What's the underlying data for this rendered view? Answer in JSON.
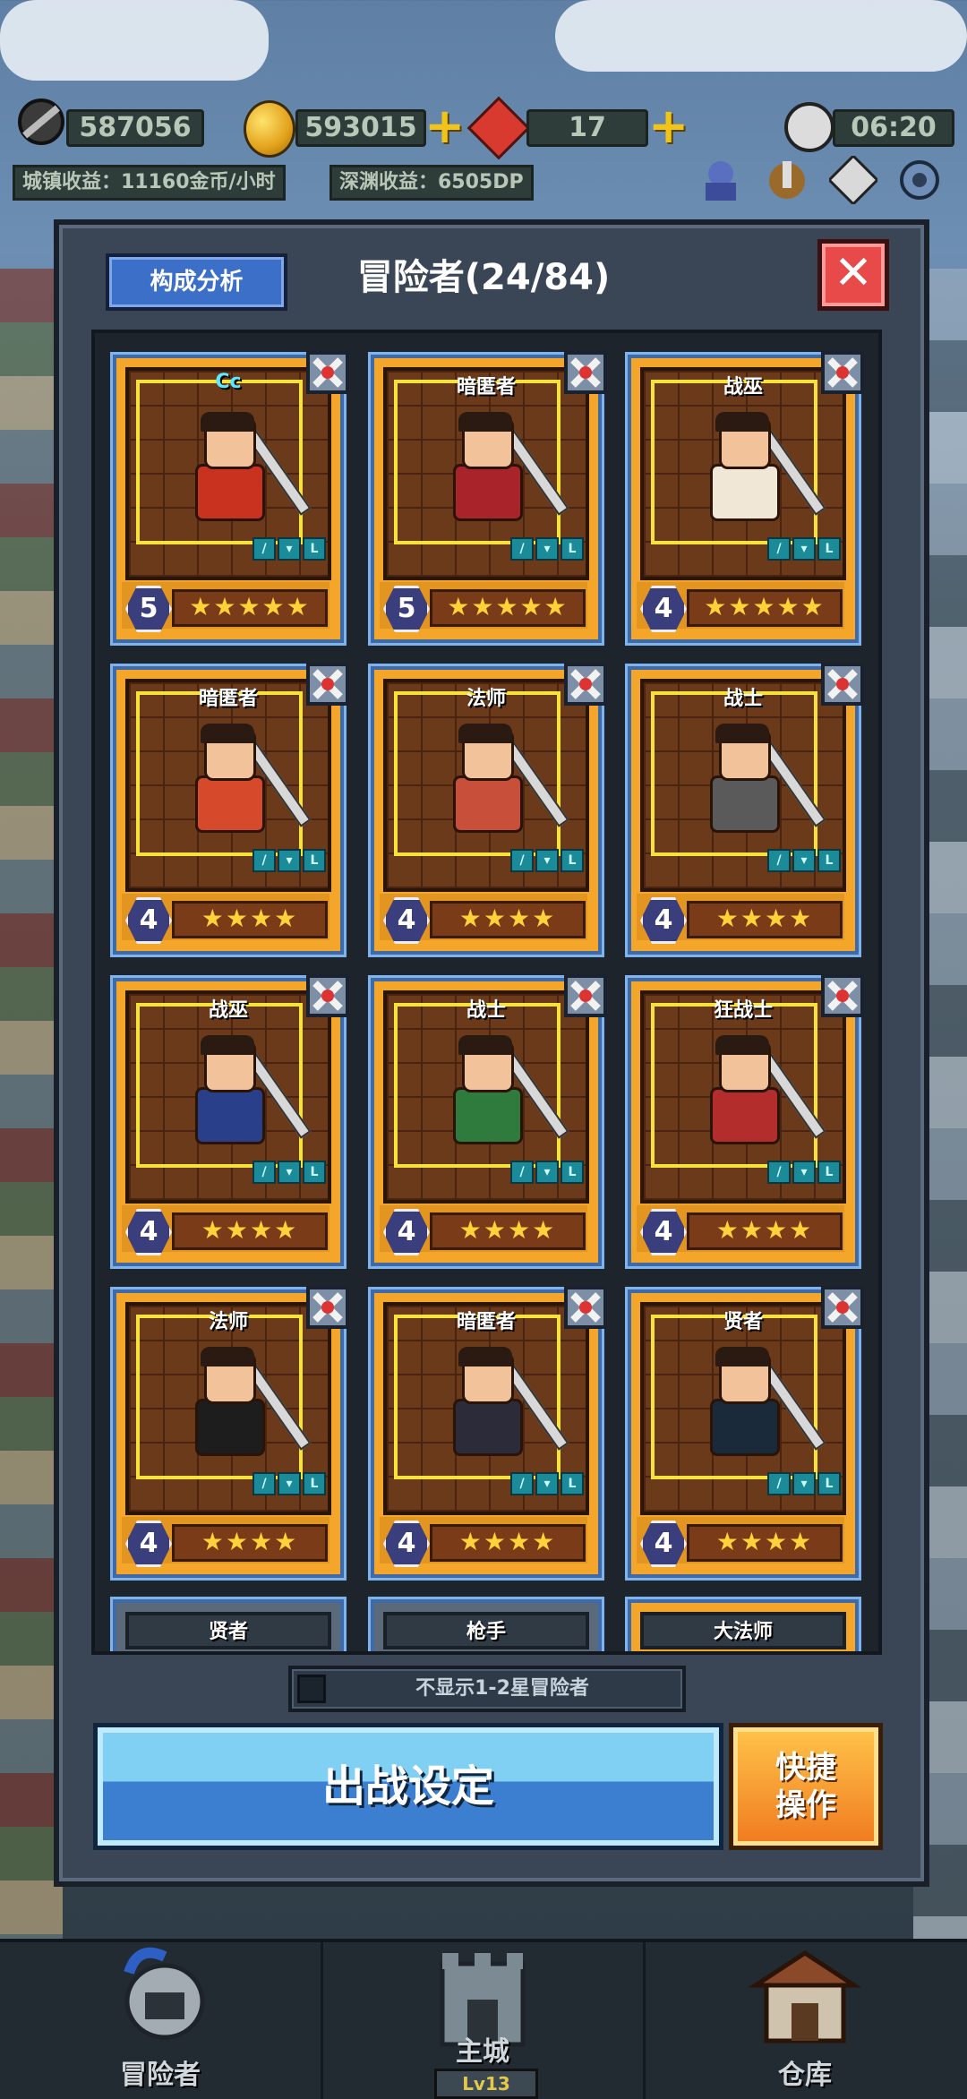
{
  "hud": {
    "power": "587056",
    "gold": "593015",
    "gems": "17",
    "time": "06:20",
    "town_income": "城镇收益：11160金币/小时",
    "abyss_income": "深渊收益：6505DP",
    "icons": [
      "sword-icon",
      "coin-icon",
      "gem-icon",
      "clock-icon",
      "summon-icon",
      "battle-icon",
      "map-icon",
      "settings-gear-icon"
    ]
  },
  "panel": {
    "analysis_label": "构成分析",
    "title": "冒险者(24/84)",
    "close_label": "✕"
  },
  "cards": [
    {
      "class": "Cc",
      "level": "5",
      "stars": "★★★★★",
      "highlight": true,
      "body_color": "#c8321e"
    },
    {
      "class": "暗匿者",
      "level": "5",
      "stars": "★★★★★",
      "highlight": false,
      "body_color": "#a9232a"
    },
    {
      "class": "战巫",
      "level": "4",
      "stars": "★★★★★",
      "highlight": false,
      "body_color": "#f1e7d6"
    },
    {
      "class": "暗匿者",
      "level": "4",
      "stars": "★★★★",
      "highlight": false,
      "body_color": "#d64a2b"
    },
    {
      "class": "法师",
      "level": "4",
      "stars": "★★★★",
      "highlight": false,
      "body_color": "#c84f3a"
    },
    {
      "class": "战士",
      "level": "4",
      "stars": "★★★★",
      "highlight": false,
      "body_color": "#5a5a5a"
    },
    {
      "class": "战巫",
      "level": "4",
      "stars": "★★★★",
      "highlight": false,
      "body_color": "#2a3f8a"
    },
    {
      "class": "战士",
      "level": "4",
      "stars": "★★★★",
      "highlight": false,
      "body_color": "#2f7a3d"
    },
    {
      "class": "狂战士",
      "level": "4",
      "stars": "★★★★",
      "highlight": false,
      "body_color": "#b32d2d"
    },
    {
      "class": "法师",
      "level": "4",
      "stars": "★★★★",
      "highlight": false,
      "body_color": "#1d1d1d"
    },
    {
      "class": "暗匿者",
      "level": "4",
      "stars": "★★★★",
      "highlight": false,
      "body_color": "#2b2b3a"
    },
    {
      "class": "贤者",
      "level": "4",
      "stars": "★★★★",
      "highlight": false,
      "body_color": "#1b2a3a"
    }
  ],
  "partial_cards": [
    "贤者",
    "枪手",
    "大法师"
  ],
  "filter_label": "不显示1-2星冒险者",
  "deploy_label": "出战设定",
  "quick_label_1": "快捷",
  "quick_label_2": "操作",
  "nav": {
    "adventurer": "冒险者",
    "main_city": "主城",
    "main_city_level": "Lv13",
    "warehouse": "仓库"
  }
}
